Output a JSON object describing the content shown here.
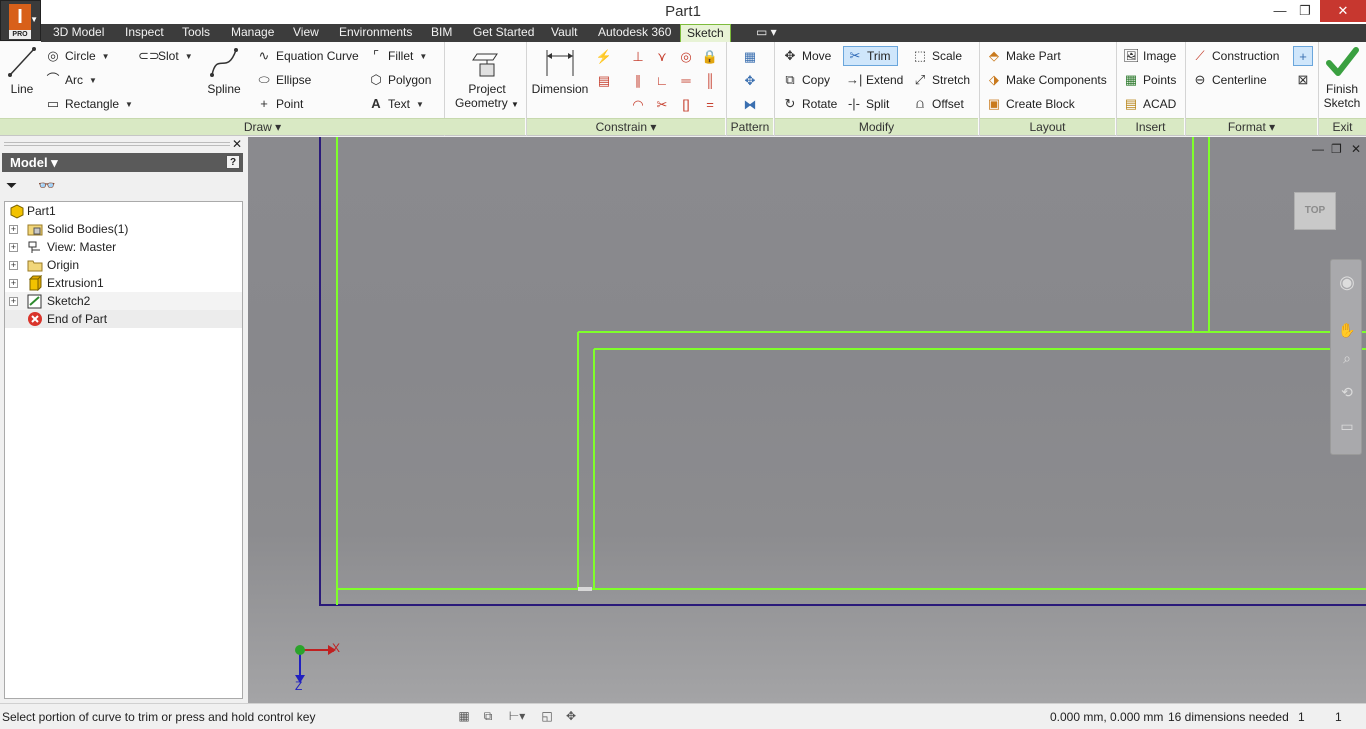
{
  "window": {
    "title": "Part1",
    "app_logo_letter": "I",
    "app_badge": "PRO",
    "controls": {
      "minimize": "—",
      "restore": "❐",
      "close": "✕"
    }
  },
  "tabs": [
    {
      "label": "3D Model"
    },
    {
      "label": "Inspect"
    },
    {
      "label": "Tools"
    },
    {
      "label": "Manage"
    },
    {
      "label": "View"
    },
    {
      "label": "Environments"
    },
    {
      "label": "BIM"
    },
    {
      "label": "Get Started"
    },
    {
      "label": "Vault"
    },
    {
      "label": "Autodesk 360"
    },
    {
      "label": "Sketch"
    }
  ],
  "ribbon": {
    "draw": {
      "panel_label": "Draw ▾",
      "line": "Line",
      "circle": "Circle",
      "arc": "Arc",
      "rectangle": "Rectangle",
      "slot": "Slot",
      "spline": "Spline",
      "equation_curve": "Equation Curve",
      "ellipse": "Ellipse",
      "point": "Point",
      "fillet": "Fillet",
      "polygon": "Polygon",
      "text": "Text",
      "project_geometry_1": "Project",
      "project_geometry_2": "Geometry"
    },
    "constrain": {
      "panel_label": "Constrain ▾",
      "dimension": "Dimension"
    },
    "pattern": {
      "panel_label": "Pattern"
    },
    "modify": {
      "panel_label": "Modify",
      "move": "Move",
      "copy": "Copy",
      "rotate": "Rotate",
      "trim": "Trim",
      "extend": "Extend",
      "split": "Split",
      "scale": "Scale",
      "stretch": "Stretch",
      "offset": "Offset"
    },
    "layout": {
      "panel_label": "Layout",
      "make_part": "Make Part",
      "make_components": "Make Components",
      "create_block": "Create Block"
    },
    "insert": {
      "panel_label": "Insert",
      "image": "Image",
      "points": "Points",
      "acad": "ACAD"
    },
    "format": {
      "panel_label": "Format ▾",
      "construction": "Construction",
      "centerline": "Centerline"
    },
    "exit": {
      "panel_label": "Exit",
      "finish_1": "Finish",
      "finish_2": "Sketch"
    }
  },
  "browser": {
    "title": "Model ▾",
    "help": "?",
    "close": "✕",
    "tree": [
      {
        "label": "Part1"
      },
      {
        "label": "Solid Bodies(1)"
      },
      {
        "label": "View: Master"
      },
      {
        "label": "Origin"
      },
      {
        "label": "Extrusion1"
      },
      {
        "label": "Sketch2"
      },
      {
        "label": "End of Part"
      }
    ]
  },
  "viewport": {
    "viewcube_label": "TOP",
    "axis_x": "X",
    "axis_z": "Z",
    "controls": {
      "minimize": "—",
      "restore": "❐",
      "close": "✕"
    }
  },
  "statusbar": {
    "prompt": "Select portion of curve to trim or press and hold control key",
    "coordinates": "0.000 mm, 0.000 mm",
    "dimensions_needed": "16 dimensions needed",
    "count_1": "1",
    "count_2": "1"
  },
  "colors": {
    "sketch_line": "#7fff2a",
    "part_edge": "#2a1a7a",
    "accent_tab": "#7dbb3c",
    "finish_check": "#3aa040"
  }
}
